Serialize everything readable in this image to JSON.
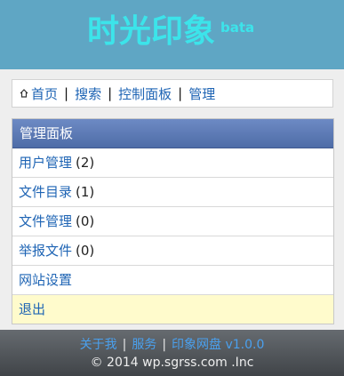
{
  "header": {
    "logo_text": "时光印象",
    "logo_sup": "bata"
  },
  "breadcrumb": {
    "home": "首页",
    "items": [
      "搜索",
      "控制面板",
      "管理"
    ]
  },
  "panel": {
    "title": "管理面板",
    "items": [
      {
        "label": "用户管理",
        "count": "(2)"
      },
      {
        "label": "文件目录",
        "count": "(1)"
      },
      {
        "label": "文件管理",
        "count": "(0)"
      },
      {
        "label": "举报文件",
        "count": "(0)"
      },
      {
        "label": "网站设置"
      },
      {
        "label": "退出"
      }
    ]
  },
  "footer": {
    "links": [
      "关于我",
      "服务",
      "印象网盘 v1.0.0"
    ],
    "copyright": "© 2014 wp.sgrss.com .Inc"
  },
  "colors": {
    "header_bg": "#5fa6c4",
    "logo": "#3ce4ea",
    "link": "#1e64b4",
    "panel_title_bg": "#5a78b4",
    "logout_bg": "#fffbcc",
    "footer_link": "#4aa0ee"
  },
  "icons": {
    "home": "home-icon"
  }
}
